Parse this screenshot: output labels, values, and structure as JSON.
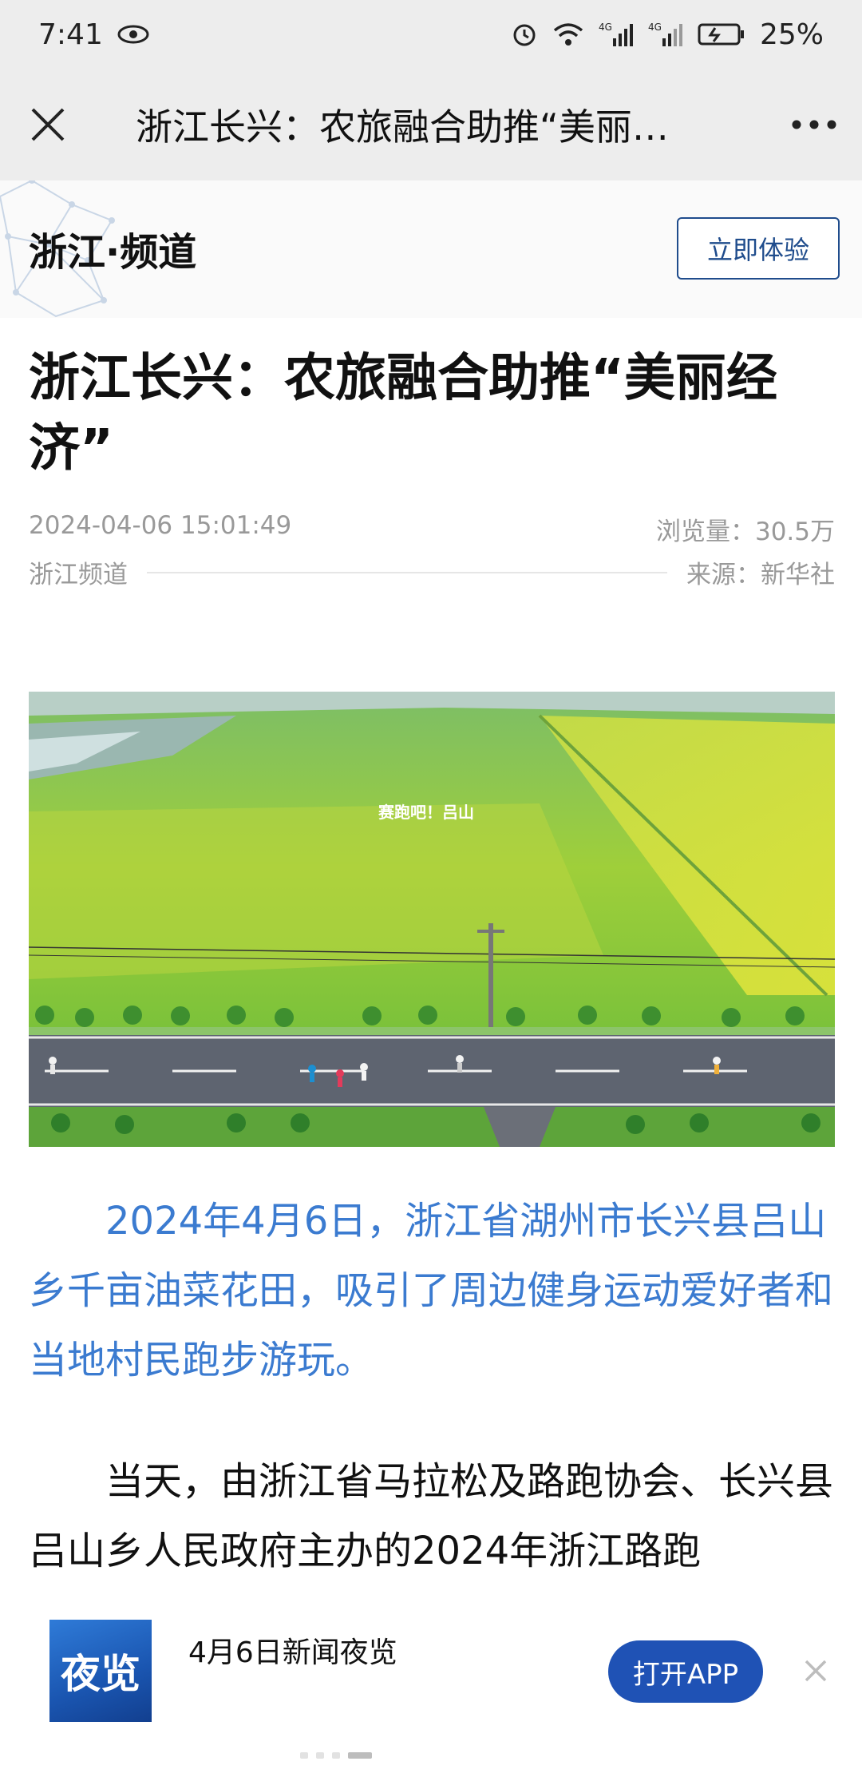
{
  "status_bar": {
    "time": "7:41",
    "battery": "25%",
    "signal1": "4G",
    "signal2": "4G"
  },
  "nav": {
    "title": "浙江长兴：农旅融合助推“美丽…"
  },
  "channel": {
    "name": "浙江·频道",
    "try_button": "立即体验"
  },
  "article": {
    "headline": "浙江长兴：农旅融合助推“美丽经济”",
    "datetime": "2024-04-06 15:01:49",
    "views": "浏览量：30.5万",
    "channel_label": "浙江频道",
    "source": "来源：新华社",
    "photo_sign": "赛跑吧！吕山",
    "paragraph1": "2024年4月6日，浙江省湖州市长兴县吕山乡千亩油菜花田，吸引了周边健身运动爱好者和当地村民跑步游玩。",
    "paragraph2": "当天，由浙江省马拉松及路跑协会、长兴县吕山乡人民政府主办的2024年浙江路跑"
  },
  "banner": {
    "logo_text": "夜览",
    "title": "4月6日新闻夜览",
    "open_button": "打开APP"
  },
  "colors": {
    "accent_blue": "#1f52b5",
    "lead_paragraph": "#3b7bd0",
    "bar_bg": "#ededed"
  }
}
